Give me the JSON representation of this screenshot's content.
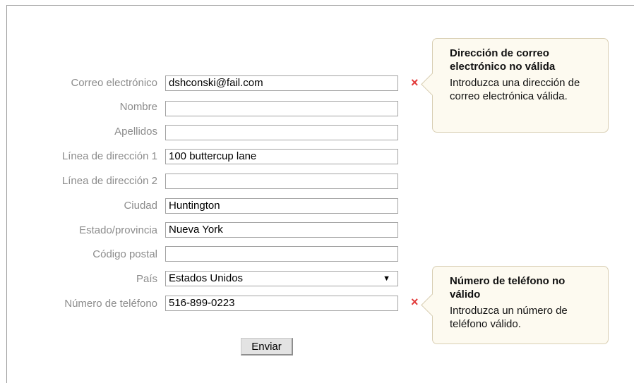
{
  "form": {
    "fields": [
      {
        "label": "Correo electrónico",
        "value": "dshconski@fail.com"
      },
      {
        "label": "Nombre",
        "value": ""
      },
      {
        "label": "Apellidos",
        "value": ""
      },
      {
        "label": "Línea de dirección 1",
        "value": "100 buttercup lane"
      },
      {
        "label": "Línea de dirección 2",
        "value": ""
      },
      {
        "label": "Ciudad",
        "value": "Huntington"
      },
      {
        "label": "Estado/provincia",
        "value": "Nueva York"
      },
      {
        "label": "Código postal",
        "value": ""
      },
      {
        "label": "País",
        "value": "Estados Unidos"
      },
      {
        "label": "Número de teléfono",
        "value": "516-899-0223"
      }
    ],
    "submit_label": "Enviar"
  },
  "errors": {
    "email": {
      "mark": "×",
      "title": "Dirección de correo electrónico no válida",
      "message": "Introduzca una dirección de correo electrónica válida."
    },
    "phone": {
      "mark": "×",
      "title": "Número de teléfono no válido",
      "message": "Introduzca un número de teléfono válido."
    }
  },
  "icons": {
    "select_arrow": "▼"
  },
  "colors": {
    "error": "#e23a3a",
    "label": "#8c8c8c",
    "tooltip_bg": "#fdfaf0"
  }
}
